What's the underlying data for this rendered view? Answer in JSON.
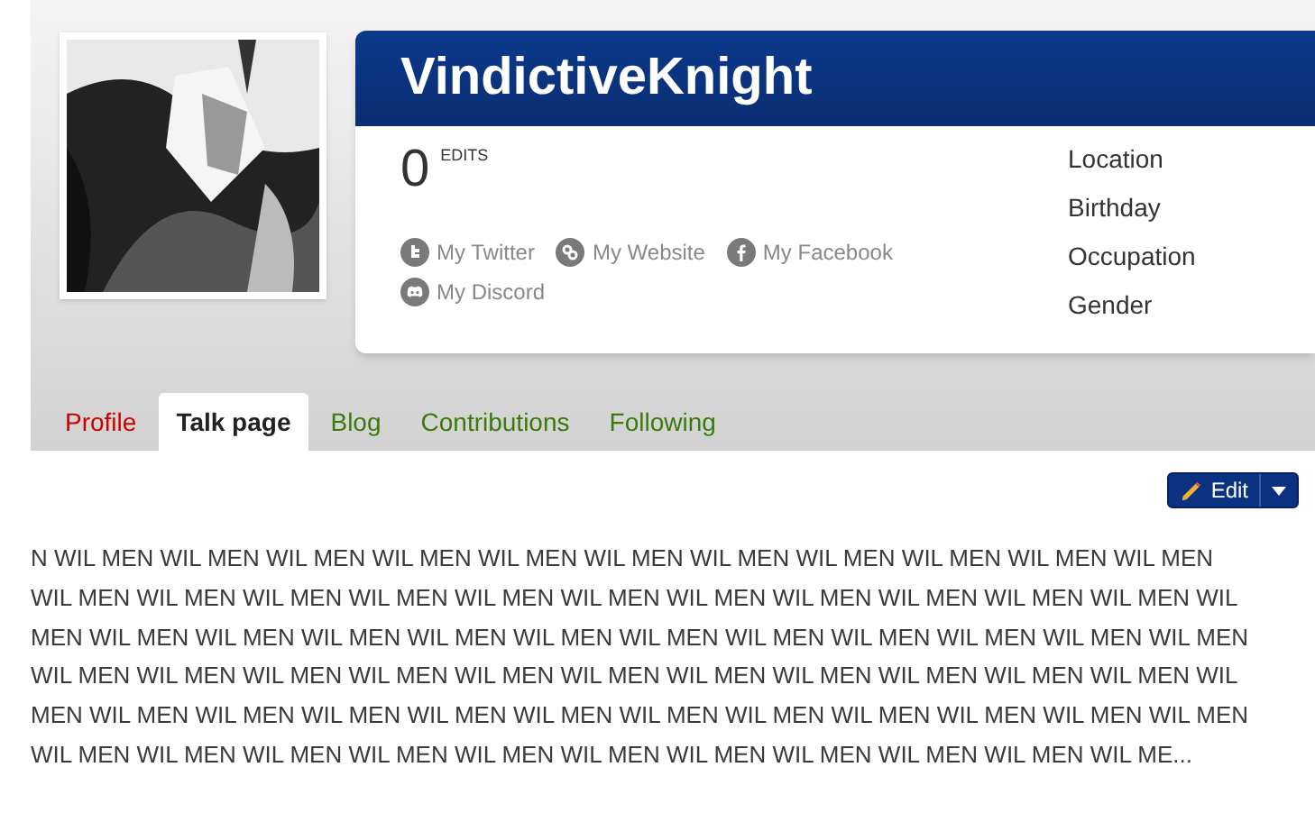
{
  "user": {
    "name": "VindictiveKnight",
    "edits_count": "0",
    "edits_label": "EDITS"
  },
  "links": [
    {
      "kind": "twitter",
      "label": "My Twitter"
    },
    {
      "kind": "website",
      "label": "My Website"
    },
    {
      "kind": "facebook",
      "label": "My Facebook"
    },
    {
      "kind": "discord",
      "label": "My Discord"
    }
  ],
  "details": [
    "Location",
    "Birthday",
    "Occupation",
    "Gender"
  ],
  "tabs": [
    {
      "label": "Profile",
      "kind": "missing",
      "selected": false
    },
    {
      "label": "Talk page",
      "kind": "normal",
      "selected": true
    },
    {
      "label": "Blog",
      "kind": "normal",
      "selected": false
    },
    {
      "label": "Contributions",
      "kind": "normal",
      "selected": false
    },
    {
      "label": "Following",
      "kind": "normal",
      "selected": false
    }
  ],
  "edit_button": {
    "label": "Edit"
  },
  "content_lines": [
    "N WIL MEN WIL MEN WIL MEN WIL MEN WIL MEN WIL MEN WIL MEN WIL MEN WIL MEN WIL MEN WIL MEN",
    "WIL MEN WIL MEN WIL MEN WIL MEN WIL MEN WIL MEN WIL MEN WIL MEN WIL MEN WIL MEN WIL MEN WIL",
    "MEN WIL MEN WIL MEN WIL MEN WIL MEN WIL MEN WIL MEN WIL MEN WIL MEN WIL MEN WIL MEN WIL MEN",
    "WIL MEN WIL MEN WIL MEN WIL MEN WIL MEN WIL MEN WIL MEN WIL MEN WIL MEN WIL MEN WIL MEN WIL",
    "MEN WIL MEN WIL MEN WIL MEN WIL MEN WIL MEN WIL MEN WIL MEN WIL MEN WIL MEN WIL MEN WIL MEN",
    "WIL MEN WIL MEN WIL MEN WIL MEN WIL MEN WIL MEN WIL MEN WIL MEN WIL MEN WIL MEN WIL ME..."
  ]
}
